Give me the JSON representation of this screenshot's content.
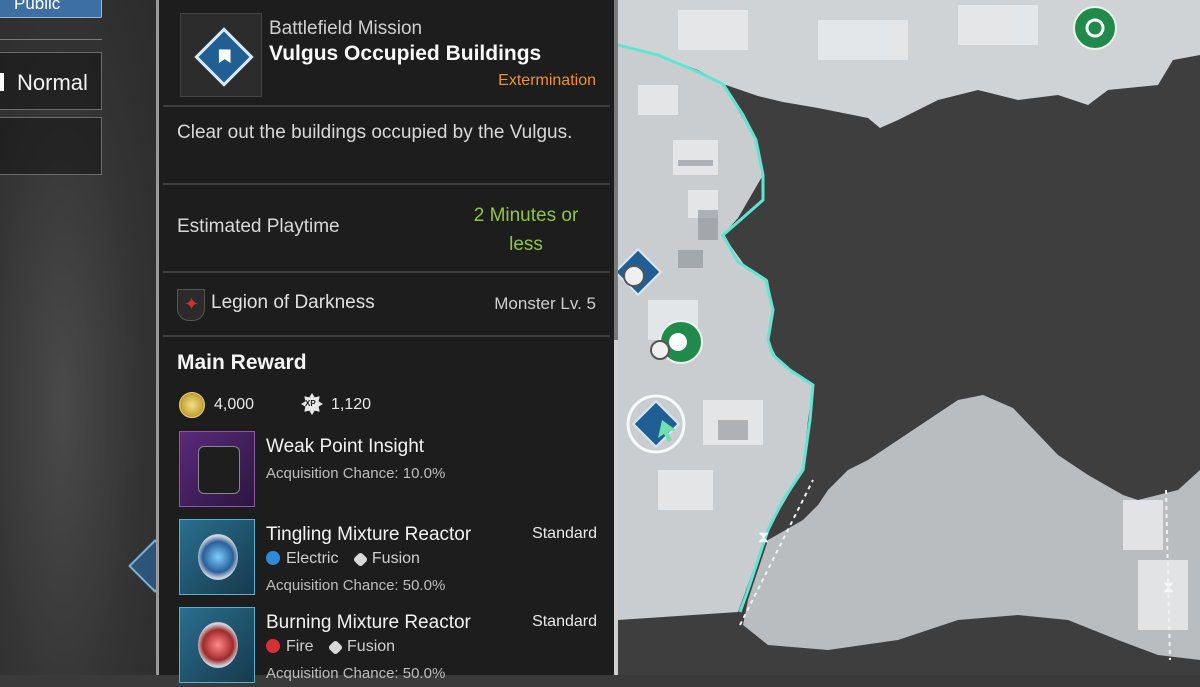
{
  "left_panel": {
    "public_label": "Public",
    "difficulty_label": "Normal"
  },
  "mission": {
    "type": "Battlefield Mission",
    "title": "Vulgus Occupied Buildings",
    "kind": "Extermination",
    "description": "Clear out the buildings occupied by the Vulgus.",
    "est_playtime_label": "Estimated Playtime",
    "est_playtime_value": "2 Minutes or less",
    "faction": "Legion of Darkness",
    "monster_level": "Monster Lv. 5"
  },
  "rewards": {
    "heading": "Main Reward",
    "gold": "4,000",
    "xp_icon_text": "XP",
    "xp": "1,120",
    "items": [
      {
        "name": "Weak Point Insight",
        "chance": "Acquisition Chance: 10.0%",
        "grade": "",
        "tags": []
      },
      {
        "name": "Tingling Mixture Reactor",
        "chance": "Acquisition Chance: 50.0%",
        "grade": "Standard",
        "tags": [
          "Electric",
          "Fusion"
        ]
      },
      {
        "name": "Burning Mixture Reactor",
        "chance": "Acquisition Chance: 50.0%",
        "grade": "Standard",
        "tags": [
          "Fire",
          "Fusion"
        ]
      }
    ]
  },
  "colors": {
    "accent_orange": "#f0932a",
    "accent_green": "#8ec63f",
    "zone_border": "#5fe6d0",
    "mission_marker": "#1f5f94"
  }
}
